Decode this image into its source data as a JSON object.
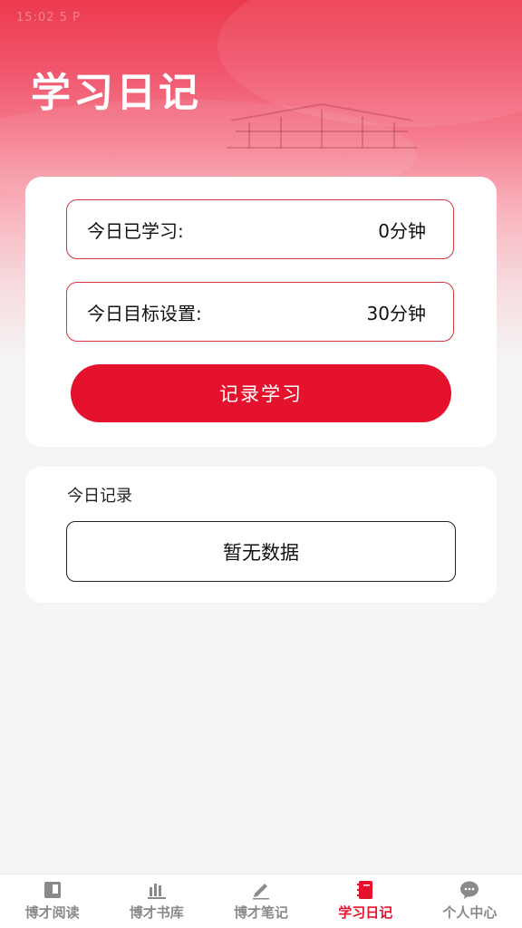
{
  "status_text": "15:02 5 P",
  "page": {
    "title": "学习日记"
  },
  "stats": {
    "today_label": "今日已学习:",
    "today_value": "0分钟",
    "goal_label": "今日目标设置:",
    "goal_value": "30分钟"
  },
  "actions": {
    "record_label": "记录学习"
  },
  "records": {
    "title": "今日记录",
    "empty_text": "暂无数据"
  },
  "tabbar": {
    "items": [
      {
        "label": "博才阅读",
        "icon": "book-icon",
        "active": false
      },
      {
        "label": "博才书库",
        "icon": "bookshelf-icon",
        "active": false
      },
      {
        "label": "博才笔记",
        "icon": "pencil-icon",
        "active": false
      },
      {
        "label": "学习日记",
        "icon": "notebook-icon",
        "active": true
      },
      {
        "label": "个人中心",
        "icon": "chat-bubble-icon",
        "active": false
      }
    ]
  },
  "colors": {
    "accent": "#e4122d",
    "inactive_tab": "#8a8a8a",
    "stat_border": "#d2353f"
  }
}
